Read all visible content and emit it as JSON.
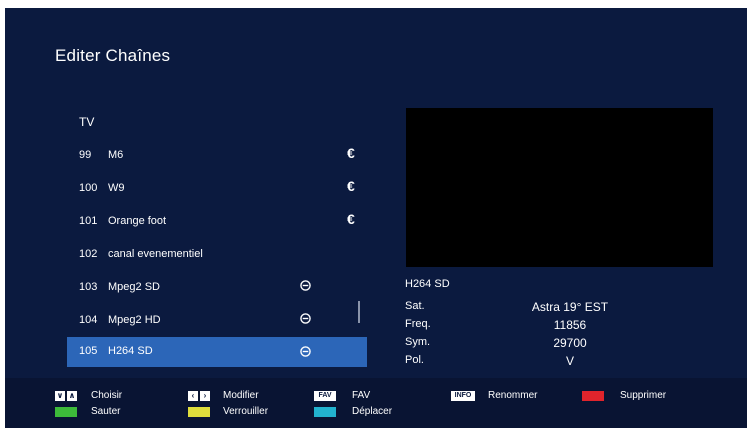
{
  "header": {
    "title": "Editer Chaînes"
  },
  "list": {
    "group_label": "TV",
    "channels": [
      {
        "number": "99",
        "name": "M6",
        "flag": "€"
      },
      {
        "number": "100",
        "name": "W9",
        "flag": "€"
      },
      {
        "number": "101",
        "name": "Orange foot",
        "flag": "€"
      },
      {
        "number": "102",
        "name": "canal evenementiel",
        "flag": ""
      },
      {
        "number": "103",
        "name": "Mpeg2 SD",
        "flag": "skip"
      },
      {
        "number": "104",
        "name": "Mpeg2 HD",
        "flag": "skip"
      },
      {
        "number": "105",
        "name": "H264 SD",
        "flag": "skip",
        "selected": true
      }
    ]
  },
  "info": {
    "channel_name": "H264 SD",
    "sat_label": "Sat.",
    "sat_value": "Astra 19° EST",
    "freq_label": "Freq.",
    "freq_value": "11856",
    "sym_label": "Sym.",
    "sym_value": "29700",
    "pol_label": "Pol.",
    "pol_value": "V"
  },
  "footer": {
    "choose_label": "Choisir",
    "modify_label": "Modifier",
    "fav_key": "FAV",
    "fav_label": "FAV",
    "info_key": "INFO",
    "rename_label": "Renommer",
    "delete_label": "Supprimer",
    "skip_label": "Sauter",
    "lock_label": "Verrouiller",
    "move_label": "Déplacer"
  },
  "colors": {
    "background": "#0b1a3f",
    "selected_row": "#2c66b8",
    "red": "#e0242c",
    "green": "#3dbb3a",
    "yellow": "#dedd3c",
    "blue": "#22b3cf"
  }
}
